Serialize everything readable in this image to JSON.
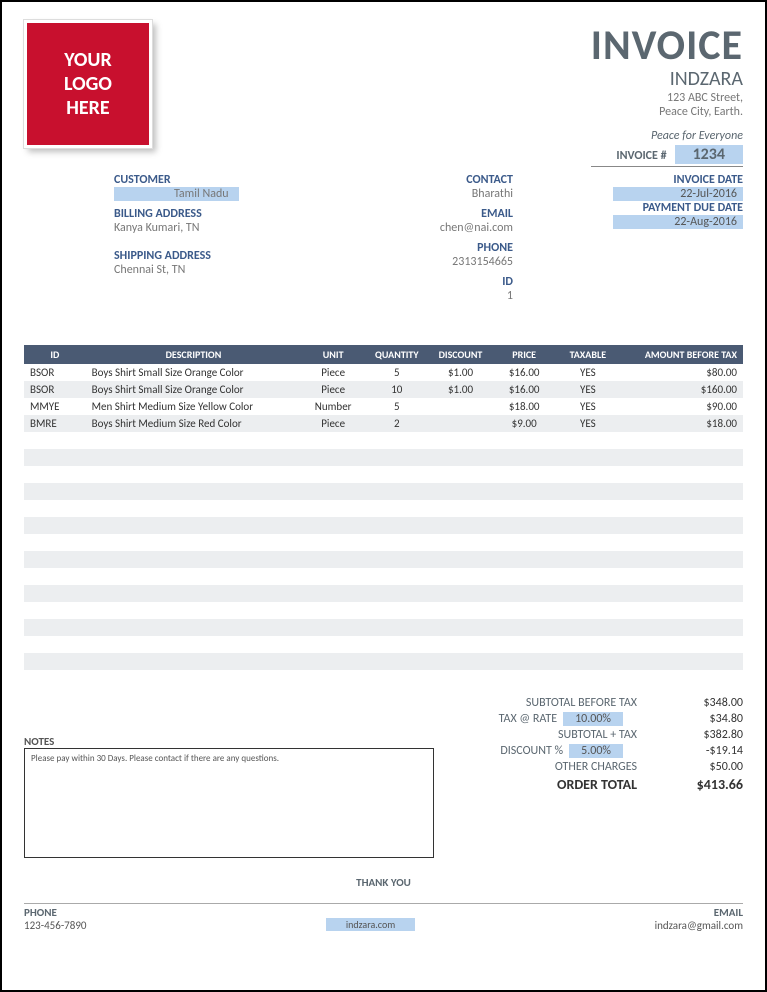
{
  "header": {
    "logo_line1": "YOUR",
    "logo_line2": "LOGO",
    "logo_line3": "HERE",
    "title": "INVOICE",
    "company": "INDZARA",
    "addr1": "123 ABC Street,",
    "addr2": "Peace City, Earth.",
    "tagline": "Peace for Everyone",
    "invoice_num_label": "INVOICE #",
    "invoice_num": "1234"
  },
  "customer": {
    "customer_label": "CUSTOMER",
    "customer_val": "Tamil Nadu",
    "billing_label": "BILLING ADDRESS",
    "billing_val": "Kanya Kumari, TN",
    "shipping_label": "SHIPPING ADDRESS",
    "shipping_val": "Chennai St, TN"
  },
  "contact": {
    "contact_label": "CONTACT",
    "contact_val": "Bharathi",
    "email_label": "EMAIL",
    "email_val": "chen@nai.com",
    "phone_label": "PHONE",
    "phone_val": "2313154665",
    "id_label": "ID",
    "id_val": "1"
  },
  "dates": {
    "inv_date_label": "INVOICE DATE",
    "inv_date_val": "22-Jul-2016",
    "due_date_label": "PAYMENT DUE DATE",
    "due_date_val": "22-Aug-2016"
  },
  "cols": {
    "id": "ID",
    "desc": "DESCRIPTION",
    "unit": "UNIT",
    "qty": "QUANTITY",
    "disc": "DISCOUNT",
    "price": "PRICE",
    "tax": "TAXABLE",
    "amt": "AMOUNT BEFORE TAX"
  },
  "rows": [
    {
      "id": "BSOR",
      "desc": "Boys Shirt Small Size Orange Color",
      "unit": "Piece",
      "qty": "5",
      "disc": "$1.00",
      "price": "$16.00",
      "tax": "YES",
      "amt": "$80.00"
    },
    {
      "id": "BSOR",
      "desc": "Boys Shirt Small Size Orange Color",
      "unit": "Piece",
      "qty": "10",
      "disc": "$1.00",
      "price": "$16.00",
      "tax": "YES",
      "amt": "$160.00"
    },
    {
      "id": "MMYE",
      "desc": "Men Shirt Medium Size Yellow Color",
      "unit": "Number",
      "qty": "5",
      "disc": "",
      "price": "$18.00",
      "tax": "YES",
      "amt": "$90.00"
    },
    {
      "id": "BMRE",
      "desc": "Boys Shirt Medium Size Red Color",
      "unit": "Piece",
      "qty": "2",
      "disc": "",
      "price": "$9.00",
      "tax": "YES",
      "amt": "$18.00"
    }
  ],
  "empty_row_count": 15,
  "totals": {
    "subtotal_label": "SUBTOTAL BEFORE TAX",
    "subtotal_val": "$348.00",
    "taxrate_label": "TAX @ RATE",
    "taxrate_pct": "10.00%",
    "taxrate_val": "$34.80",
    "subtax_label": "SUBTOTAL + TAX",
    "subtax_val": "$382.80",
    "disc_label": "DISCOUNT %",
    "disc_pct": "5.00%",
    "disc_val": "-$19.14",
    "other_label": "OTHER CHARGES",
    "other_val": "$50.00",
    "total_label": "ORDER TOTAL",
    "total_val": "$413.66"
  },
  "notes": {
    "label": "NOTES",
    "text": "Please pay within 30 Days. Please contact if there are any questions."
  },
  "footer": {
    "thanks": "THANK YOU",
    "phone_label": "PHONE",
    "phone_val": "123-456-7890",
    "website": "indzara.com",
    "email_label": "EMAIL",
    "email_val": "indzara@gmail.com"
  }
}
